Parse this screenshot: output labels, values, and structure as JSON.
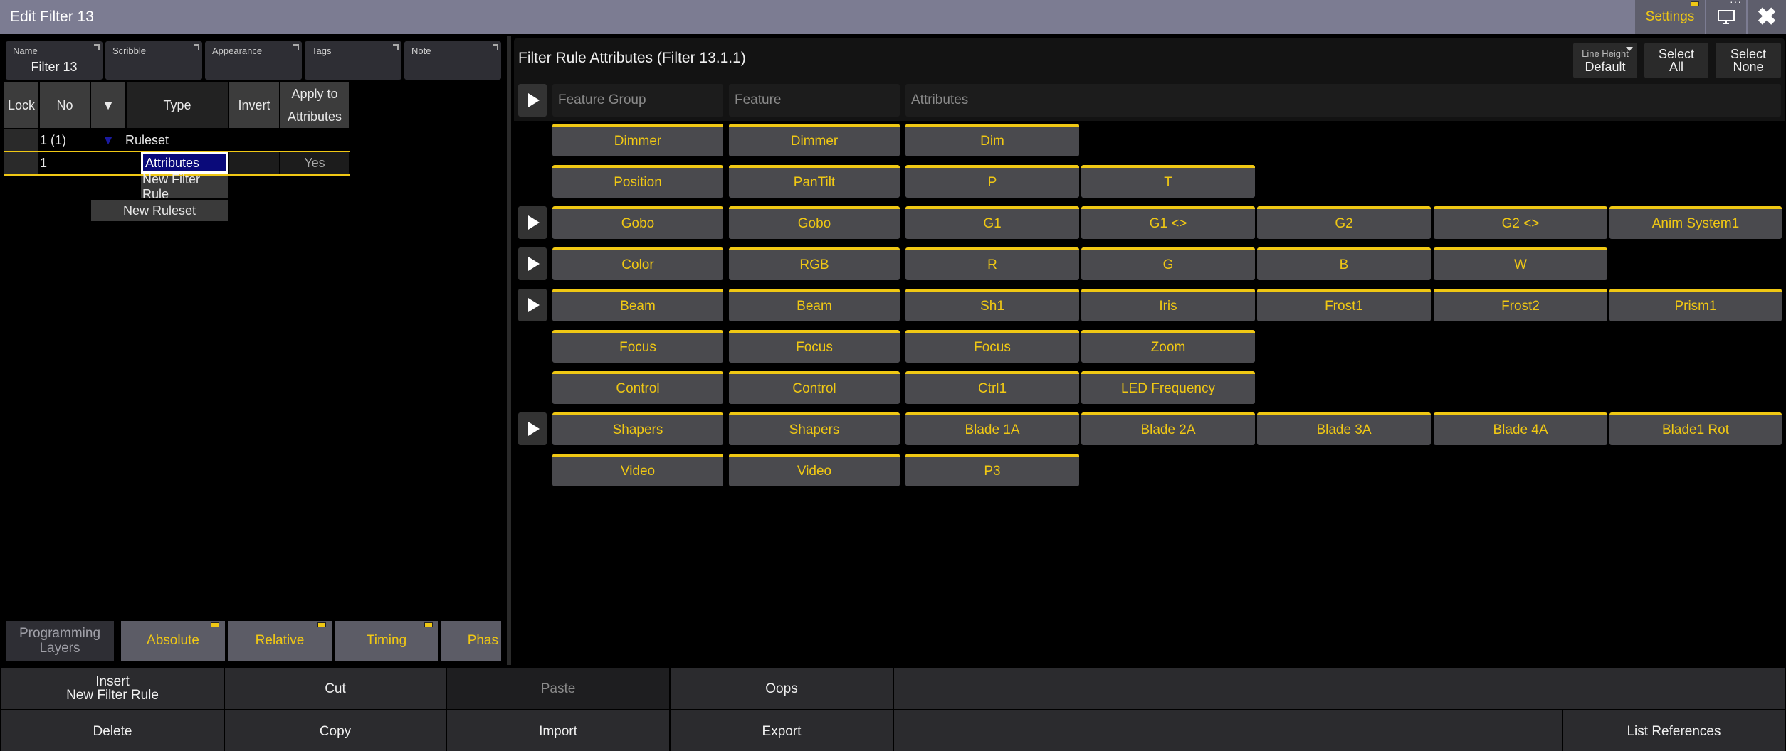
{
  "window": {
    "title": "Edit Filter 13",
    "settings_label": "Settings"
  },
  "props": [
    {
      "label": "Name",
      "value": "Filter 13"
    },
    {
      "label": "Scribble",
      "value": ""
    },
    {
      "label": "Appearance",
      "value": ""
    },
    {
      "label": "Tags",
      "value": ""
    },
    {
      "label": "Note",
      "value": ""
    }
  ],
  "grid": {
    "headers": {
      "lock": "Lock",
      "no": "No",
      "sort": "▼",
      "type": "Type",
      "invert": "Invert",
      "apply_1": "Apply to",
      "apply_2": "Attributes"
    },
    "ruleset_row": {
      "no": "1 (1)",
      "type": "Ruleset"
    },
    "rule_row": {
      "no": "1",
      "type": "Attributes",
      "apply": "Yes"
    },
    "new_filter_rule": "New Filter Rule",
    "new_ruleset": "New Ruleset"
  },
  "bottom_tabs": [
    {
      "label": "Programming Layers",
      "active": false
    },
    {
      "label": "Absolute",
      "active": true
    },
    {
      "label": "Relative",
      "active": true
    },
    {
      "label": "Timing",
      "active": true
    },
    {
      "label": "Phas",
      "active": true
    }
  ],
  "right": {
    "title": "Filter Rule Attributes (Filter 13.1.1)",
    "line_height": {
      "label": "Line Height",
      "value": "Default"
    },
    "select_all": [
      "Select",
      "All"
    ],
    "select_none": [
      "Select",
      "None"
    ],
    "col_headers": [
      "Feature Group",
      "Feature",
      "Attributes"
    ],
    "rows": [
      {
        "play": false,
        "cells": [
          "Dimmer",
          "Dimmer",
          "Dim"
        ]
      },
      {
        "play": false,
        "cells": [
          "Position",
          "PanTilt",
          "P",
          "T"
        ]
      },
      {
        "play": true,
        "cells": [
          "Gobo",
          "Gobo",
          "G1",
          "G1 <>",
          "G2",
          "G2 <>",
          "Anim System1"
        ]
      },
      {
        "play": true,
        "cells": [
          "Color",
          "RGB",
          "R",
          "G",
          "B",
          "W"
        ]
      },
      {
        "play": true,
        "cells": [
          "Beam",
          "Beam",
          "Sh1",
          "Iris",
          "Frost1",
          "Frost2",
          "Prism1"
        ]
      },
      {
        "play": false,
        "cells": [
          "Focus",
          "Focus",
          "Focus",
          "Zoom"
        ]
      },
      {
        "play": false,
        "cells": [
          "Control",
          "Control",
          "Ctrl1",
          "LED Frequency"
        ]
      },
      {
        "play": true,
        "cells": [
          "Shapers",
          "Shapers",
          "Blade 1A",
          "Blade 2A",
          "Blade 3A",
          "Blade 4A",
          "Blade1 Rot"
        ]
      },
      {
        "play": false,
        "cells": [
          "Video",
          "Video",
          "P3"
        ]
      }
    ]
  },
  "bottom_bar": {
    "insert": [
      "Insert",
      "New Filter Rule"
    ],
    "cut": "Cut",
    "paste": "Paste",
    "oops": "Oops",
    "delete": "Delete",
    "copy": "Copy",
    "import": "Import",
    "export": "Export",
    "list_references": "List References"
  },
  "colors": {
    "accent": "#f0c814",
    "titlebar": "#7c7c92",
    "button": "#4a4a4e"
  }
}
